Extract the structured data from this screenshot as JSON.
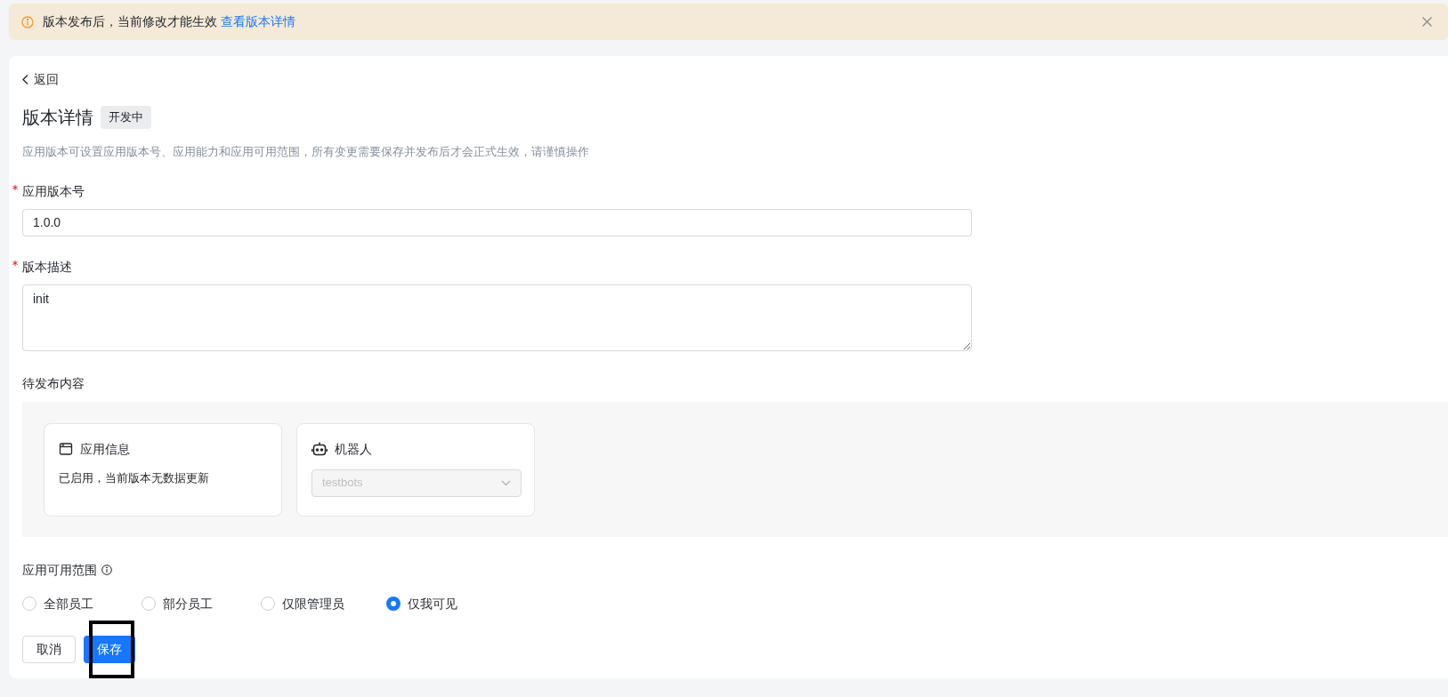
{
  "notice": {
    "text": "版本发布后，当前修改才能生效",
    "link": "查看版本详情"
  },
  "back": "返回",
  "title": "版本详情",
  "status_tag": "开发中",
  "description": "应用版本可设置应用版本号、应用能力和应用可用范围，所有变更需要保存并发布后才会正式生效，请谨慎操作",
  "fields": [
    {
      "label": "应用版本号",
      "required": true,
      "kind": "input",
      "value": "1.0.0"
    },
    {
      "label": "版本描述",
      "required": true,
      "kind": "textarea",
      "value": "init"
    }
  ],
  "pending": {
    "label": "待发布内容",
    "cards": [
      {
        "kind": "info",
        "title": "应用信息",
        "text": "已启用，当前版本无数据更新"
      },
      {
        "kind": "select",
        "title": "机器人",
        "value": "testbots",
        "disabled": true
      }
    ]
  },
  "scope": {
    "label": "应用可用范围",
    "options": [
      {
        "label": "全部员工",
        "selected": false
      },
      {
        "label": "部分员工",
        "selected": false
      },
      {
        "label": "仅限管理员",
        "selected": false
      },
      {
        "label": "仅我可见",
        "selected": true
      }
    ]
  },
  "buttons": [
    {
      "label": "取消",
      "kind": "default"
    },
    {
      "label": "保存",
      "kind": "primary",
      "highlighted": true
    }
  ]
}
